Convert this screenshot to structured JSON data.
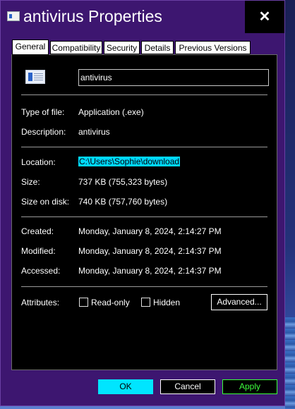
{
  "window": {
    "title": "antivirus Properties",
    "close_glyph": "✕",
    "title_icon": "properties-window-icon"
  },
  "tabs": [
    {
      "label": "General",
      "active": true
    },
    {
      "label": "Compatibility",
      "active": false
    },
    {
      "label": "Security",
      "active": false
    },
    {
      "label": "Details",
      "active": false
    },
    {
      "label": "Previous Versions",
      "active": false
    }
  ],
  "general": {
    "file_icon": "application-file-icon",
    "name_value": "antivirus",
    "type_label": "Type of file:",
    "type_value": "Application (.exe)",
    "description_label": "Description:",
    "description_value": "antivirus",
    "location_label": "Location:",
    "location_value": "C:\\Users\\Sophie\\download",
    "size_label": "Size:",
    "size_value": "737 KB (755,323 bytes)",
    "size_on_disk_label": "Size on disk:",
    "size_on_disk_value": "740 KB (757,760 bytes)",
    "created_label": "Created:",
    "created_value": "Monday, January 8, 2024, 2:14:27 PM",
    "modified_label": "Modified:",
    "modified_value": "Monday, January 8, 2024, 2:14:37 PM",
    "accessed_label": "Accessed:",
    "accessed_value": "Monday, January 8, 2024, 2:14:37 PM",
    "attributes_label": "Attributes:",
    "readonly_label": "Read-only",
    "readonly_checked": false,
    "hidden_label": "Hidden",
    "hidden_checked": false,
    "advanced_label": "Advanced..."
  },
  "buttons": {
    "ok": "OK",
    "cancel": "Cancel",
    "apply": "Apply"
  },
  "colors": {
    "window_frame": "#3d1670",
    "panel_background": "#000000",
    "ok_background": "#00e5ff",
    "apply_text": "#3cff3c",
    "selection_highlight": "#00d8ff"
  }
}
